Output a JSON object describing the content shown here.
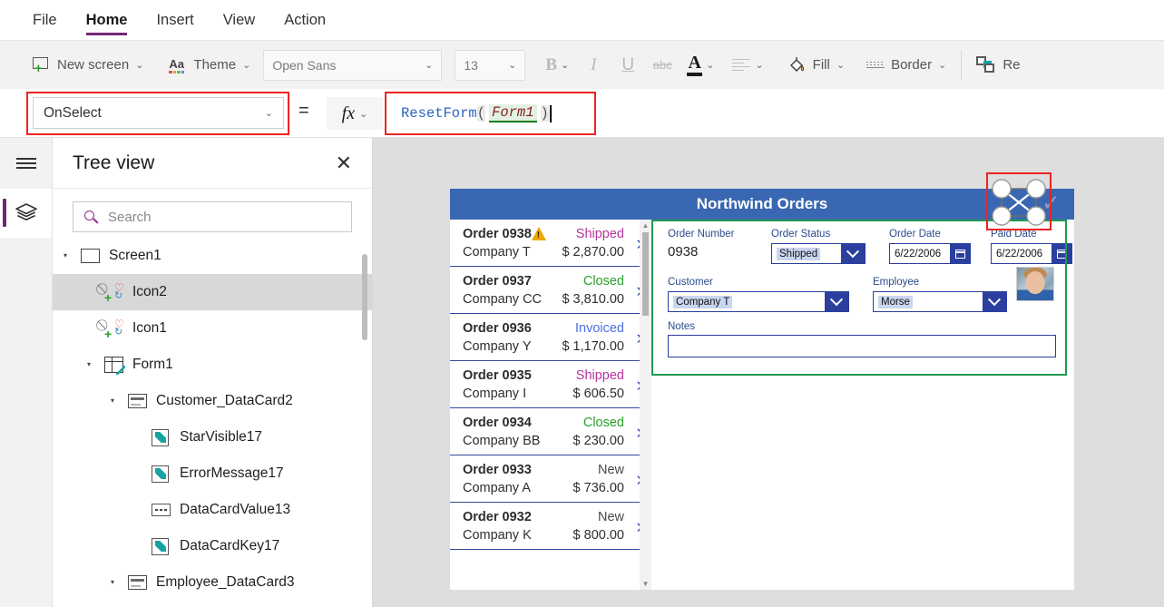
{
  "menu": {
    "items": [
      {
        "label": "File",
        "active": false
      },
      {
        "label": "Home",
        "active": true
      },
      {
        "label": "Insert",
        "active": false
      },
      {
        "label": "View",
        "active": false
      },
      {
        "label": "Action",
        "active": false
      }
    ]
  },
  "ribbon": {
    "new_screen": "New screen",
    "theme": "Theme",
    "font_family": "Open Sans",
    "font_size": "13",
    "bold": "B",
    "italic": "I",
    "underline": "U",
    "strikethrough": "abc",
    "font_color": "A",
    "align": "align",
    "fill": "Fill",
    "border": "Border",
    "reorder": "Re",
    "chevron": "⌄"
  },
  "formula_bar": {
    "property": "OnSelect",
    "equals": "=",
    "fx": "fx",
    "formula_fn": "ResetForm",
    "formula_open": "(",
    "formula_arg": "Form1",
    "formula_close": ")"
  },
  "rail": {
    "hamburger": "menu-icon",
    "tree_view_icon": "layers-icon"
  },
  "tree": {
    "title": "Tree view",
    "close": "✕",
    "search_placeholder": "Search",
    "search_value": "",
    "items": [
      {
        "label": "Screen1",
        "indent": 0,
        "caret": "▾",
        "icon": "screen",
        "selected": false
      },
      {
        "label": "Icon2",
        "indent": 1,
        "caret": "",
        "icon": "iconctl",
        "selected": true
      },
      {
        "label": "Icon1",
        "indent": 1,
        "caret": "",
        "icon": "iconctl",
        "selected": false
      },
      {
        "label": "Form1",
        "indent": 1,
        "caret": "▾",
        "icon": "form",
        "selected": false
      },
      {
        "label": "Customer_DataCard2",
        "indent": 2,
        "caret": "▾",
        "icon": "card",
        "selected": false
      },
      {
        "label": "StarVisible17",
        "indent": 3,
        "caret": "",
        "icon": "pen",
        "selected": false
      },
      {
        "label": "ErrorMessage17",
        "indent": 3,
        "caret": "",
        "icon": "pen",
        "selected": false
      },
      {
        "label": "DataCardValue13",
        "indent": 3,
        "caret": "",
        "icon": "textinput",
        "selected": false
      },
      {
        "label": "DataCardKey17",
        "indent": 3,
        "caret": "",
        "icon": "pen",
        "selected": false
      },
      {
        "label": "Employee_DataCard3",
        "indent": 2,
        "caret": "▾",
        "icon": "card",
        "selected": false
      }
    ]
  },
  "app": {
    "title": "Northwind Orders",
    "gallery": [
      {
        "order": "Order 0938",
        "company": "Company T",
        "status": "Shipped",
        "status_color": "#b4359b",
        "amount": "$ 2,870.00",
        "warning": true
      },
      {
        "order": "Order 0937",
        "company": "Company CC",
        "status": "Closed",
        "status_color": "#2aa02a",
        "amount": "$ 3,810.00",
        "warning": false
      },
      {
        "order": "Order 0936",
        "company": "Company Y",
        "status": "Invoiced",
        "status_color": "#4a6fe0",
        "amount": "$ 1,170.00",
        "warning": false
      },
      {
        "order": "Order 0935",
        "company": "Company I",
        "status": "Shipped",
        "status_color": "#b4359b",
        "amount": "$ 606.50",
        "warning": false
      },
      {
        "order": "Order 0934",
        "company": "Company BB",
        "status": "Closed",
        "status_color": "#2aa02a",
        "amount": "$ 230.00",
        "warning": false
      },
      {
        "order": "Order 0933",
        "company": "Company A",
        "status": "New",
        "status_color": "#4a4a4a",
        "amount": "$ 736.00",
        "warning": false
      },
      {
        "order": "Order 0932",
        "company": "Company K",
        "status": "New",
        "status_color": "#4a4a4a",
        "amount": "$ 800.00",
        "warning": false
      }
    ],
    "arrow": "›",
    "form": {
      "order_number_label": "Order Number",
      "order_number_value": "0938",
      "order_status_label": "Order Status",
      "order_status_value": "Shipped",
      "order_date_label": "Order Date",
      "order_date_value": "6/22/2006",
      "paid_date_label": "Paid Date",
      "paid_date_value": "6/22/2006",
      "customer_label": "Customer",
      "customer_value": "Company T",
      "employee_label": "Employee",
      "employee_value": "Morse",
      "notes_label": "Notes",
      "notes_value": ""
    }
  },
  "colors": {
    "accent_purple": "#742774",
    "app_header_blue": "#3a67b1",
    "selection_green": "#1d9a4e",
    "annotation_red": "#ee2222",
    "field_border_blue": "#2b3f9e"
  }
}
